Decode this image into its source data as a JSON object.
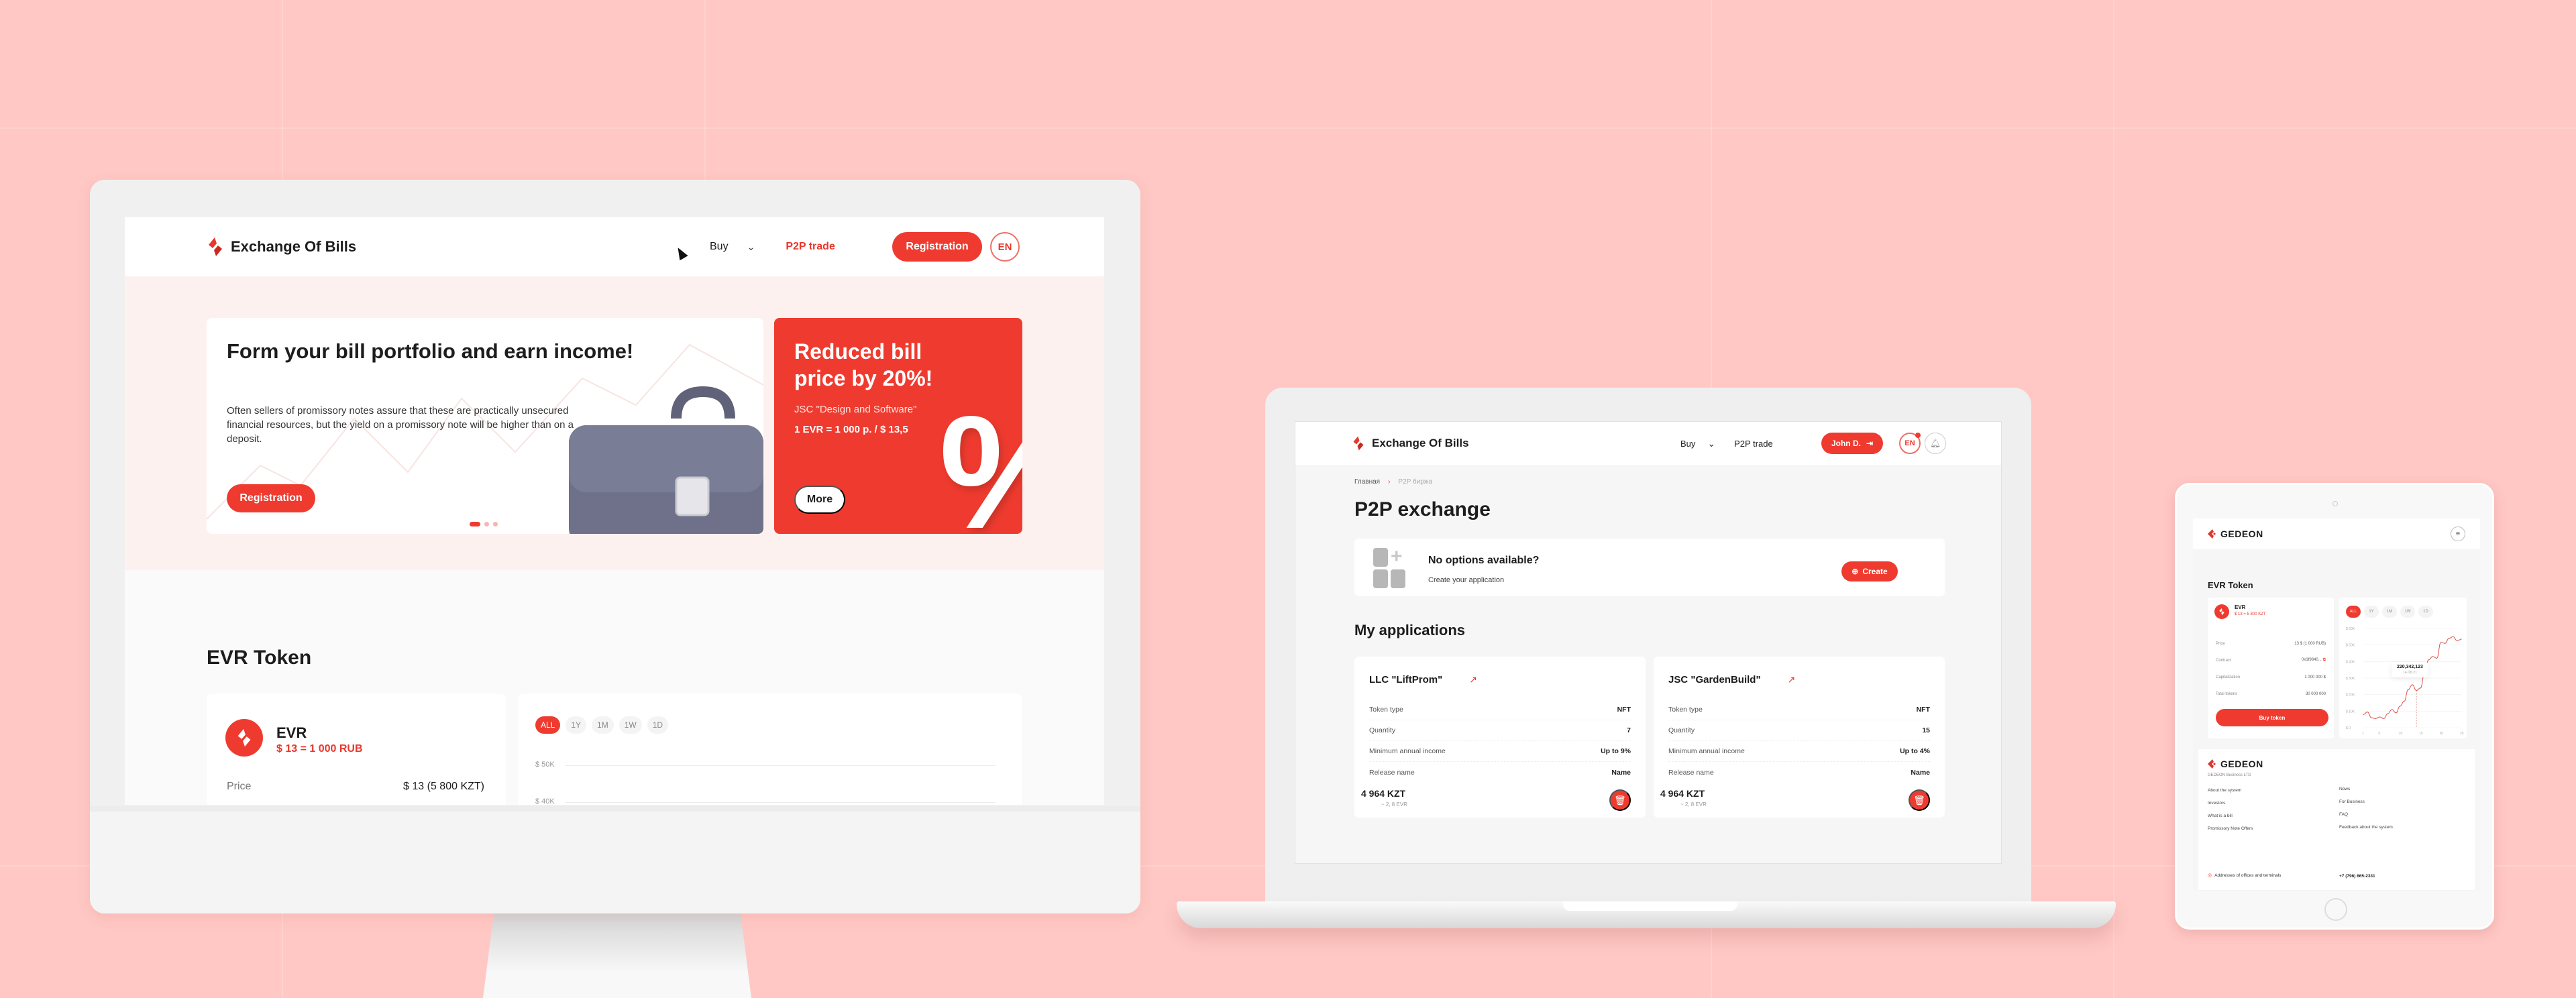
{
  "colors": {
    "accent": "#ef3b2f",
    "background": "#ffc8c4",
    "text": "#1d1d1f"
  },
  "desktop": {
    "brand": "Exchange Of Bills",
    "nav": {
      "buy": "Buy",
      "p2p": "P2P trade"
    },
    "registration_label": "Registration",
    "lang": "EN",
    "hero": {
      "title": "Form your bill portfolio and earn income!",
      "description": "Often sellers of promissory notes assure that these are practically unsecured financial resources, but the yield on a promissory note will be higher than on a deposit.",
      "button": "Registration",
      "slides": 3,
      "active_slide": 1
    },
    "promo": {
      "title": "Reduced bill price by 20%!",
      "company": "JSC \"Design and Software\"",
      "rate": "1 EVR = 1 000 p. / $ 13,5",
      "button": "More",
      "glyph": "%"
    },
    "token": {
      "section_title": "EVR Token",
      "name": "EVR",
      "rate": "$ 13 = 1 000 RUB",
      "price_label": "Price",
      "price_value": "$ 13 (5 800 KZT)"
    },
    "chart": {
      "ranges": [
        "ALL",
        "1Y",
        "1M",
        "1W",
        "1D"
      ],
      "active_range": "ALL",
      "yticks": [
        "$ 50K",
        "$ 40K"
      ]
    }
  },
  "laptop": {
    "brand": "Exchange Of Bills",
    "nav": {
      "buy": "Buy",
      "p2p": "P2P trade"
    },
    "user": "John D.",
    "lang": "EN",
    "breadcrumb": [
      "Главная",
      "P2P биржа"
    ],
    "title": "P2P exchange",
    "empty": {
      "title": "No options available?",
      "subtitle": "Create your application",
      "button": "Create"
    },
    "applications_title": "My applications",
    "applications": [
      {
        "title": "LLC \"LiftProm\"",
        "rows": [
          {
            "label": "Token type",
            "value": "NFT"
          },
          {
            "label": "Quantity",
            "value": "7"
          },
          {
            "label": "Minimum annual income",
            "value": "Up to 9%"
          },
          {
            "label": "Release name",
            "value": "Name"
          }
        ],
        "price": "4 964 KZT",
        "evr": "~ 2, 8 EVR"
      },
      {
        "title": "JSC \"GardenBuild\"",
        "rows": [
          {
            "label": "Token type",
            "value": "NFT"
          },
          {
            "label": "Quantity",
            "value": "15"
          },
          {
            "label": "Minimum annual income",
            "value": "Up to 4%"
          },
          {
            "label": "Release name",
            "value": "Name"
          }
        ],
        "price": "4 964 KZT",
        "evr": "~ 2, 8 EVR"
      }
    ]
  },
  "tablet": {
    "brand": "GEDEON",
    "section_title": "EVR Token",
    "token": {
      "name": "EVR",
      "rate": "$ 13 = 5 800 KZT",
      "rows": [
        {
          "label": "Price",
          "value": "13 $ (1 000 RUB)"
        },
        {
          "label": "Contract",
          "value": "0x1f9840..."
        },
        {
          "label": "Capitalization",
          "value": "1 000 000 $"
        },
        {
          "label": "Total tokens",
          "value": "30 000 000"
        }
      ],
      "buy_label": "Buy token"
    },
    "chart": {
      "ranges": [
        "ALL",
        "1Y",
        "1M",
        "1W",
        "1D"
      ],
      "active_range": "ALL",
      "tooltip_value": "220,342,123",
      "tooltip_date": "14.08.21"
    },
    "footer": {
      "brand": "GEDEON",
      "company": "GEDEON Business LTD",
      "col1": [
        "About the system",
        "Investors",
        "What is a bill",
        "Promissory Note Offers"
      ],
      "col2": [
        "News",
        "For Business",
        "FAQ",
        "Feedback about the system"
      ],
      "address": "Addresses of offices and terminals",
      "phone": "+7 (796) 665-2331"
    }
  },
  "chart_data": {
    "type": "line",
    "title": "",
    "xlabel": "",
    "ylabel": "",
    "x": [
      1,
      2,
      3,
      4,
      5,
      6,
      7,
      8,
      9,
      10,
      11,
      12,
      13,
      14,
      15,
      16,
      17,
      18,
      19,
      20,
      21,
      22,
      23,
      24,
      25
    ],
    "xticks": [
      "1",
      "5",
      "10",
      "15",
      "20",
      "25"
    ],
    "yticks": [
      "$ 0",
      "$ 10K",
      "$ 20K",
      "$ 30K",
      "$ 40K",
      "$ 50K",
      "$ 60K"
    ],
    "ylim": [
      0,
      60000
    ],
    "series": [
      {
        "name": "EVR",
        "values": [
          8000,
          9500,
          6000,
          5500,
          6500,
          5500,
          8500,
          11000,
          9000,
          13000,
          16000,
          23000,
          26000,
          22500,
          24000,
          33000,
          41000,
          43000,
          42000,
          51500,
          51000,
          54000,
          55000,
          52500,
          53500
        ]
      }
    ],
    "grid": true,
    "legend": "none"
  }
}
